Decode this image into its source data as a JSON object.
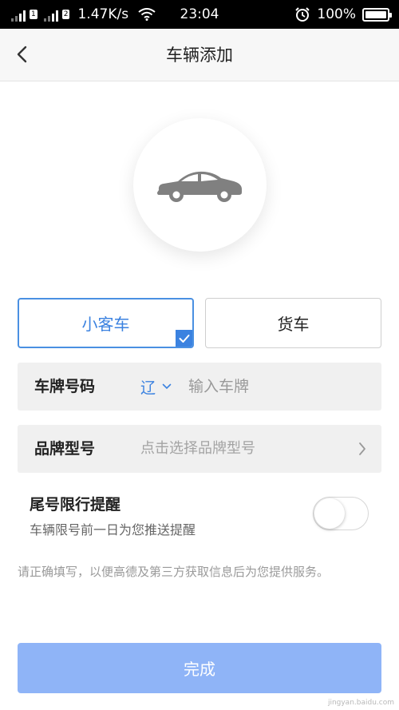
{
  "status_bar": {
    "network_speed": "1.47K/s",
    "time": "23:04",
    "battery": "100%",
    "battery_level": 1.0,
    "sim1_label": "1",
    "sim2_label": "2"
  },
  "header": {
    "title": "车辆添加",
    "back_icon": "chevron-left-icon"
  },
  "vehicle_icon": "car-icon",
  "vehicle_types": {
    "selected": "小客车",
    "other": "货车"
  },
  "plate": {
    "label": "车牌号码",
    "province": "辽",
    "placeholder": "输入车牌",
    "value": ""
  },
  "brand": {
    "label": "品牌型号",
    "placeholder": "点击选择品牌型号"
  },
  "reminder": {
    "title": "尾号限行提醒",
    "subtitle": "车辆限号前一日为您推送提醒",
    "enabled": false
  },
  "notice": "请正确填写，以便高德及第三方获取信息后为您提供服务。",
  "submit_label": "完成",
  "watermark": "jingyan.baidu.com",
  "colors": {
    "accent": "#3b82e0",
    "submit_disabled": "#8fb4f7",
    "field_bg": "#f0f0f0",
    "car_icon": "#808080"
  }
}
